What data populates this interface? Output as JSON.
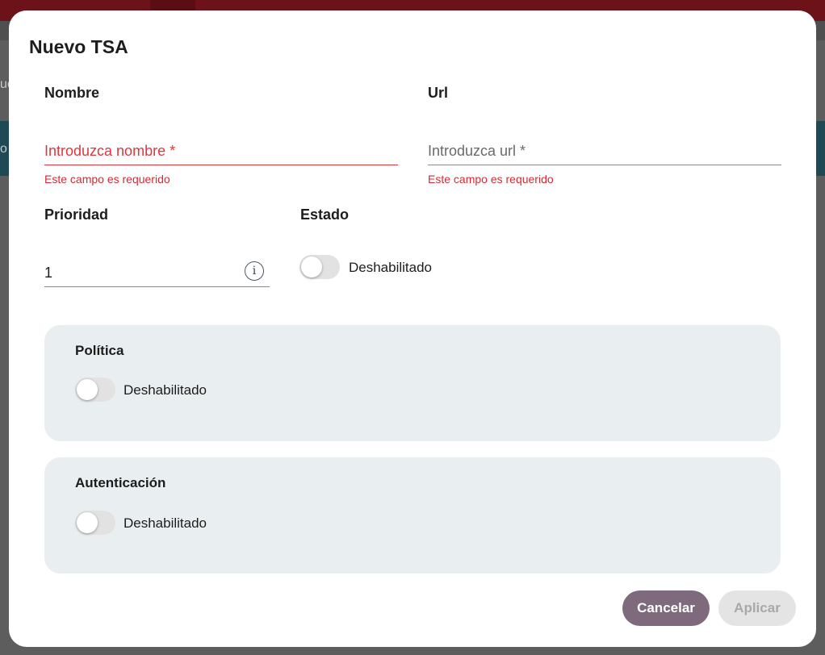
{
  "background": {
    "fragment_1": "ue",
    "fragment_2": "o"
  },
  "dialog": {
    "title": "Nuevo TSA"
  },
  "form": {
    "nombre": {
      "label": "Nombre",
      "value": "",
      "placeholder": "Introduzca nombre *",
      "error": "Este campo es requerido"
    },
    "url": {
      "label": "Url",
      "value": "",
      "placeholder": "Introduzca url *",
      "error": "Este campo es requerido"
    },
    "prioridad": {
      "label": "Prioridad",
      "value": "1",
      "info_icon": "i"
    },
    "estado": {
      "label": "Estado",
      "toggle_label": "Deshabilitado",
      "enabled": false
    }
  },
  "politica": {
    "title": "Política",
    "toggle_label": "Deshabilitado",
    "enabled": false
  },
  "autenticacion": {
    "title": "Autenticación",
    "toggle_label": "Deshabilitado",
    "enabled": false
  },
  "actions": {
    "cancel_label": "Cancelar",
    "apply_label": "Aplicar"
  },
  "colors": {
    "error": "#d52b34",
    "cancel_button": "#7f6a7d",
    "apply_button_disabled": "#e4e4e4",
    "panel_background": "#e9eef0",
    "topbar": "#6e1219"
  },
  "icons": {
    "info": "info-icon"
  }
}
